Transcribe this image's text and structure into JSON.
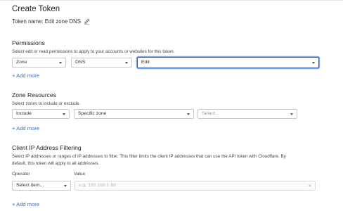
{
  "page": {
    "title": "Create Token",
    "token_name": "Token name: Edit zone DNS"
  },
  "permissions": {
    "heading": "Permissions",
    "description": "Select edit or read permissions to apply to your accounts or websites for this token.",
    "row": {
      "scope": "Zone",
      "group": "DNS",
      "level": "Edit"
    },
    "add_more": "+ Add more"
  },
  "zone_resources": {
    "heading": "Zone Resources",
    "description": "Select zones to include or exclude.",
    "row": {
      "mode": "Include",
      "target": "Specific zone",
      "zone_placeholder": "Select..."
    },
    "add_more": "+ Add more"
  },
  "ip_filtering": {
    "heading": "Client IP Address Filtering",
    "description_line1": "Select IP addresses or ranges of IP addresses to filter. This filter limits the client IP addresses that can use the API token with Cloudflare. By",
    "description_line2": "default, this token will apply to all addresses.",
    "operator_label": "Operator",
    "value_label": "Value",
    "operator_placeholder": "Select item...",
    "value_placeholder": "e.g. 192.168.1.88",
    "add_more": "+ Add more"
  },
  "icons": {
    "edit": "pencil-icon",
    "dropdown": "chevron-down-icon"
  },
  "colors": {
    "link": "#2f6ed3",
    "focus_border": "#2b5fc7"
  }
}
